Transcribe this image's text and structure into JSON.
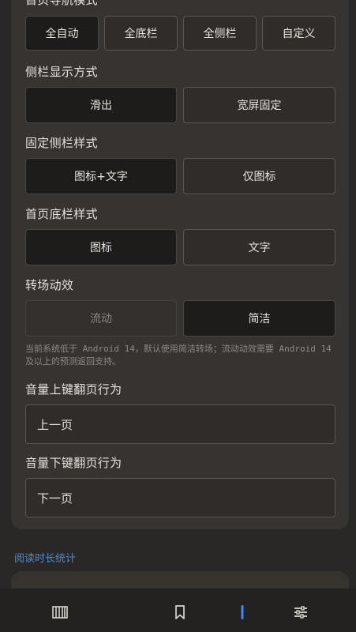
{
  "sections": {
    "nav_mode": {
      "title": "首页导航模式",
      "options": [
        "全自动",
        "全底栏",
        "全侧栏",
        "自定义"
      ]
    },
    "sidebar_display": {
      "title": "侧栏显示方式",
      "options": [
        "滑出",
        "宽屏固定"
      ]
    },
    "fixed_sidebar_style": {
      "title": "固定侧栏样式",
      "options": [
        "图标+文字",
        "仅图标"
      ]
    },
    "home_bottom_style": {
      "title": "首页底栏样式",
      "options": [
        "图标",
        "文字"
      ]
    },
    "transition": {
      "title": "转场动效",
      "options": [
        "流动",
        "简洁"
      ],
      "hint": "当前系统低于 Android 14，默认使用简洁转场；流动动效需要 Android 14 及以上的预测返回支持。"
    },
    "volume_up": {
      "title": "音量上键翻页行为",
      "value": "上一页"
    },
    "volume_down": {
      "title": "音量下键翻页行为",
      "value": "下一页"
    }
  },
  "reading_stats": {
    "title": "阅读时长统计"
  },
  "bottom_nav": {
    "items": [
      "bookshelf-icon",
      "bookmark-icon",
      "active-indicator",
      "settings-sliders-icon"
    ],
    "accent_color": "#3d8af7"
  }
}
